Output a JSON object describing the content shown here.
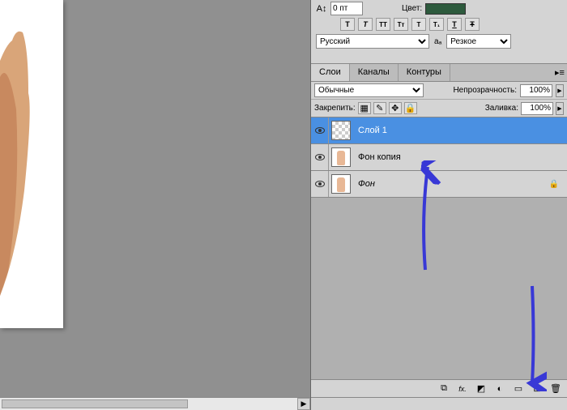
{
  "char_panel": {
    "leading_icon": "A↕",
    "leading_value": "0 пт",
    "color_label": "Цвет:",
    "color_value": "#2d5a3d",
    "text_buttons": [
      "T",
      "T",
      "TT",
      "Tт",
      "T",
      "T₁",
      "T",
      "Ŧ"
    ]
  },
  "lang_row": {
    "language": "Русский",
    "aa_icon": "aₐ",
    "aa_mode": "Резкое"
  },
  "tabs": {
    "layers": "Слои",
    "channels": "Каналы",
    "paths": "Контуры"
  },
  "opts": {
    "blend_mode": "Обычные",
    "opacity_label": "Непрозрачность:",
    "opacity_value": "100%"
  },
  "lock": {
    "label": "Закрепить:",
    "fill_label": "Заливка:",
    "fill_value": "100%"
  },
  "layers": [
    {
      "name": "Слой 1",
      "active": true,
      "thumb": "checker",
      "locked": false,
      "italic": false
    },
    {
      "name": "Фон копия",
      "active": false,
      "thumb": "hand",
      "locked": false,
      "italic": false
    },
    {
      "name": "Фон",
      "active": false,
      "thumb": "hand",
      "locked": true,
      "italic": true
    }
  ],
  "bottom_btn_icons": {
    "link": "⧉",
    "fx": "fx.",
    "mask": "◩",
    "adjust": "◐",
    "group": "▭",
    "new": "⊡",
    "delete": "🗑"
  },
  "annotation_color": "#3838d6"
}
